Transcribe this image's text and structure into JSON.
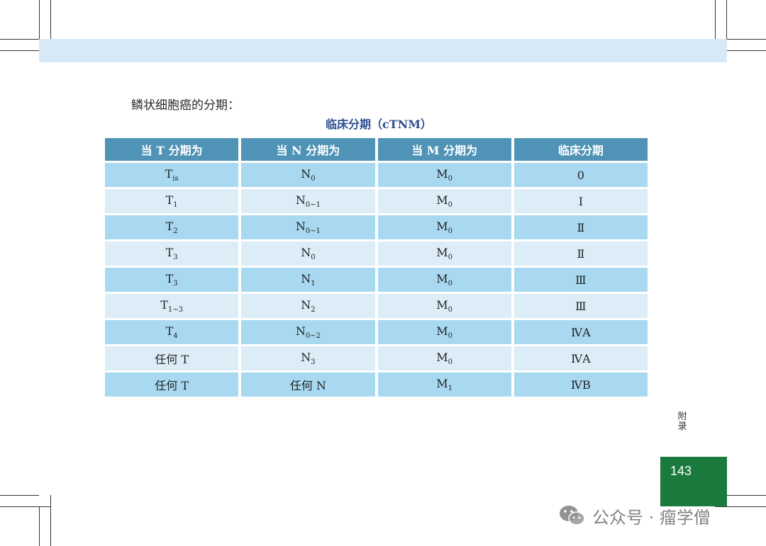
{
  "intro_text": "鳞状细胞癌的分期：",
  "table_caption": "临床分期（cTNM）",
  "table": {
    "headers": [
      "当 T 分期为",
      "当 N 分期为",
      "当 M 分期为",
      "临床分期"
    ],
    "rows": [
      [
        {
          "base": "T",
          "sub": "is"
        },
        {
          "base": "N",
          "sub": "0"
        },
        {
          "base": "M",
          "sub": "0"
        },
        {
          "base": "0",
          "sub": ""
        }
      ],
      [
        {
          "base": "T",
          "sub": "1"
        },
        {
          "base": "N",
          "sub": "0~1"
        },
        {
          "base": "M",
          "sub": "0"
        },
        {
          "base": "Ⅰ",
          "sub": ""
        }
      ],
      [
        {
          "base": "T",
          "sub": "2"
        },
        {
          "base": "N",
          "sub": "0~1"
        },
        {
          "base": "M",
          "sub": "0"
        },
        {
          "base": "Ⅱ",
          "sub": ""
        }
      ],
      [
        {
          "base": "T",
          "sub": "3"
        },
        {
          "base": "N",
          "sub": "0"
        },
        {
          "base": "M",
          "sub": "0"
        },
        {
          "base": "Ⅱ",
          "sub": ""
        }
      ],
      [
        {
          "base": "T",
          "sub": "3"
        },
        {
          "base": "N",
          "sub": "1"
        },
        {
          "base": "M",
          "sub": "0"
        },
        {
          "base": "Ⅲ",
          "sub": ""
        }
      ],
      [
        {
          "base": "T",
          "sub": "1~3"
        },
        {
          "base": "N",
          "sub": "2"
        },
        {
          "base": "M",
          "sub": "0"
        },
        {
          "base": "Ⅲ",
          "sub": ""
        }
      ],
      [
        {
          "base": "T",
          "sub": "4"
        },
        {
          "base": "N",
          "sub": "0~2"
        },
        {
          "base": "M",
          "sub": "0"
        },
        {
          "base": "ⅣA",
          "sub": ""
        }
      ],
      [
        {
          "base": "任何 T",
          "sub": ""
        },
        {
          "base": "N",
          "sub": "3"
        },
        {
          "base": "M",
          "sub": "0"
        },
        {
          "base": "ⅣA",
          "sub": ""
        }
      ],
      [
        {
          "base": "任何 T",
          "sub": ""
        },
        {
          "base": "任何 N",
          "sub": ""
        },
        {
          "base": "M",
          "sub": "1"
        },
        {
          "base": "ⅣB",
          "sub": ""
        }
      ]
    ]
  },
  "side_tab": "附录",
  "page_number": "143",
  "watermark": "公众号 · 瘤学僧",
  "colors": {
    "header_bg": "#4f93b6",
    "row_odd": "#a9d9f1",
    "row_even": "#dcedf8",
    "caption": "#2e4f93",
    "page_box": "#1a7a3e",
    "top_band": "#d7e9f6"
  }
}
